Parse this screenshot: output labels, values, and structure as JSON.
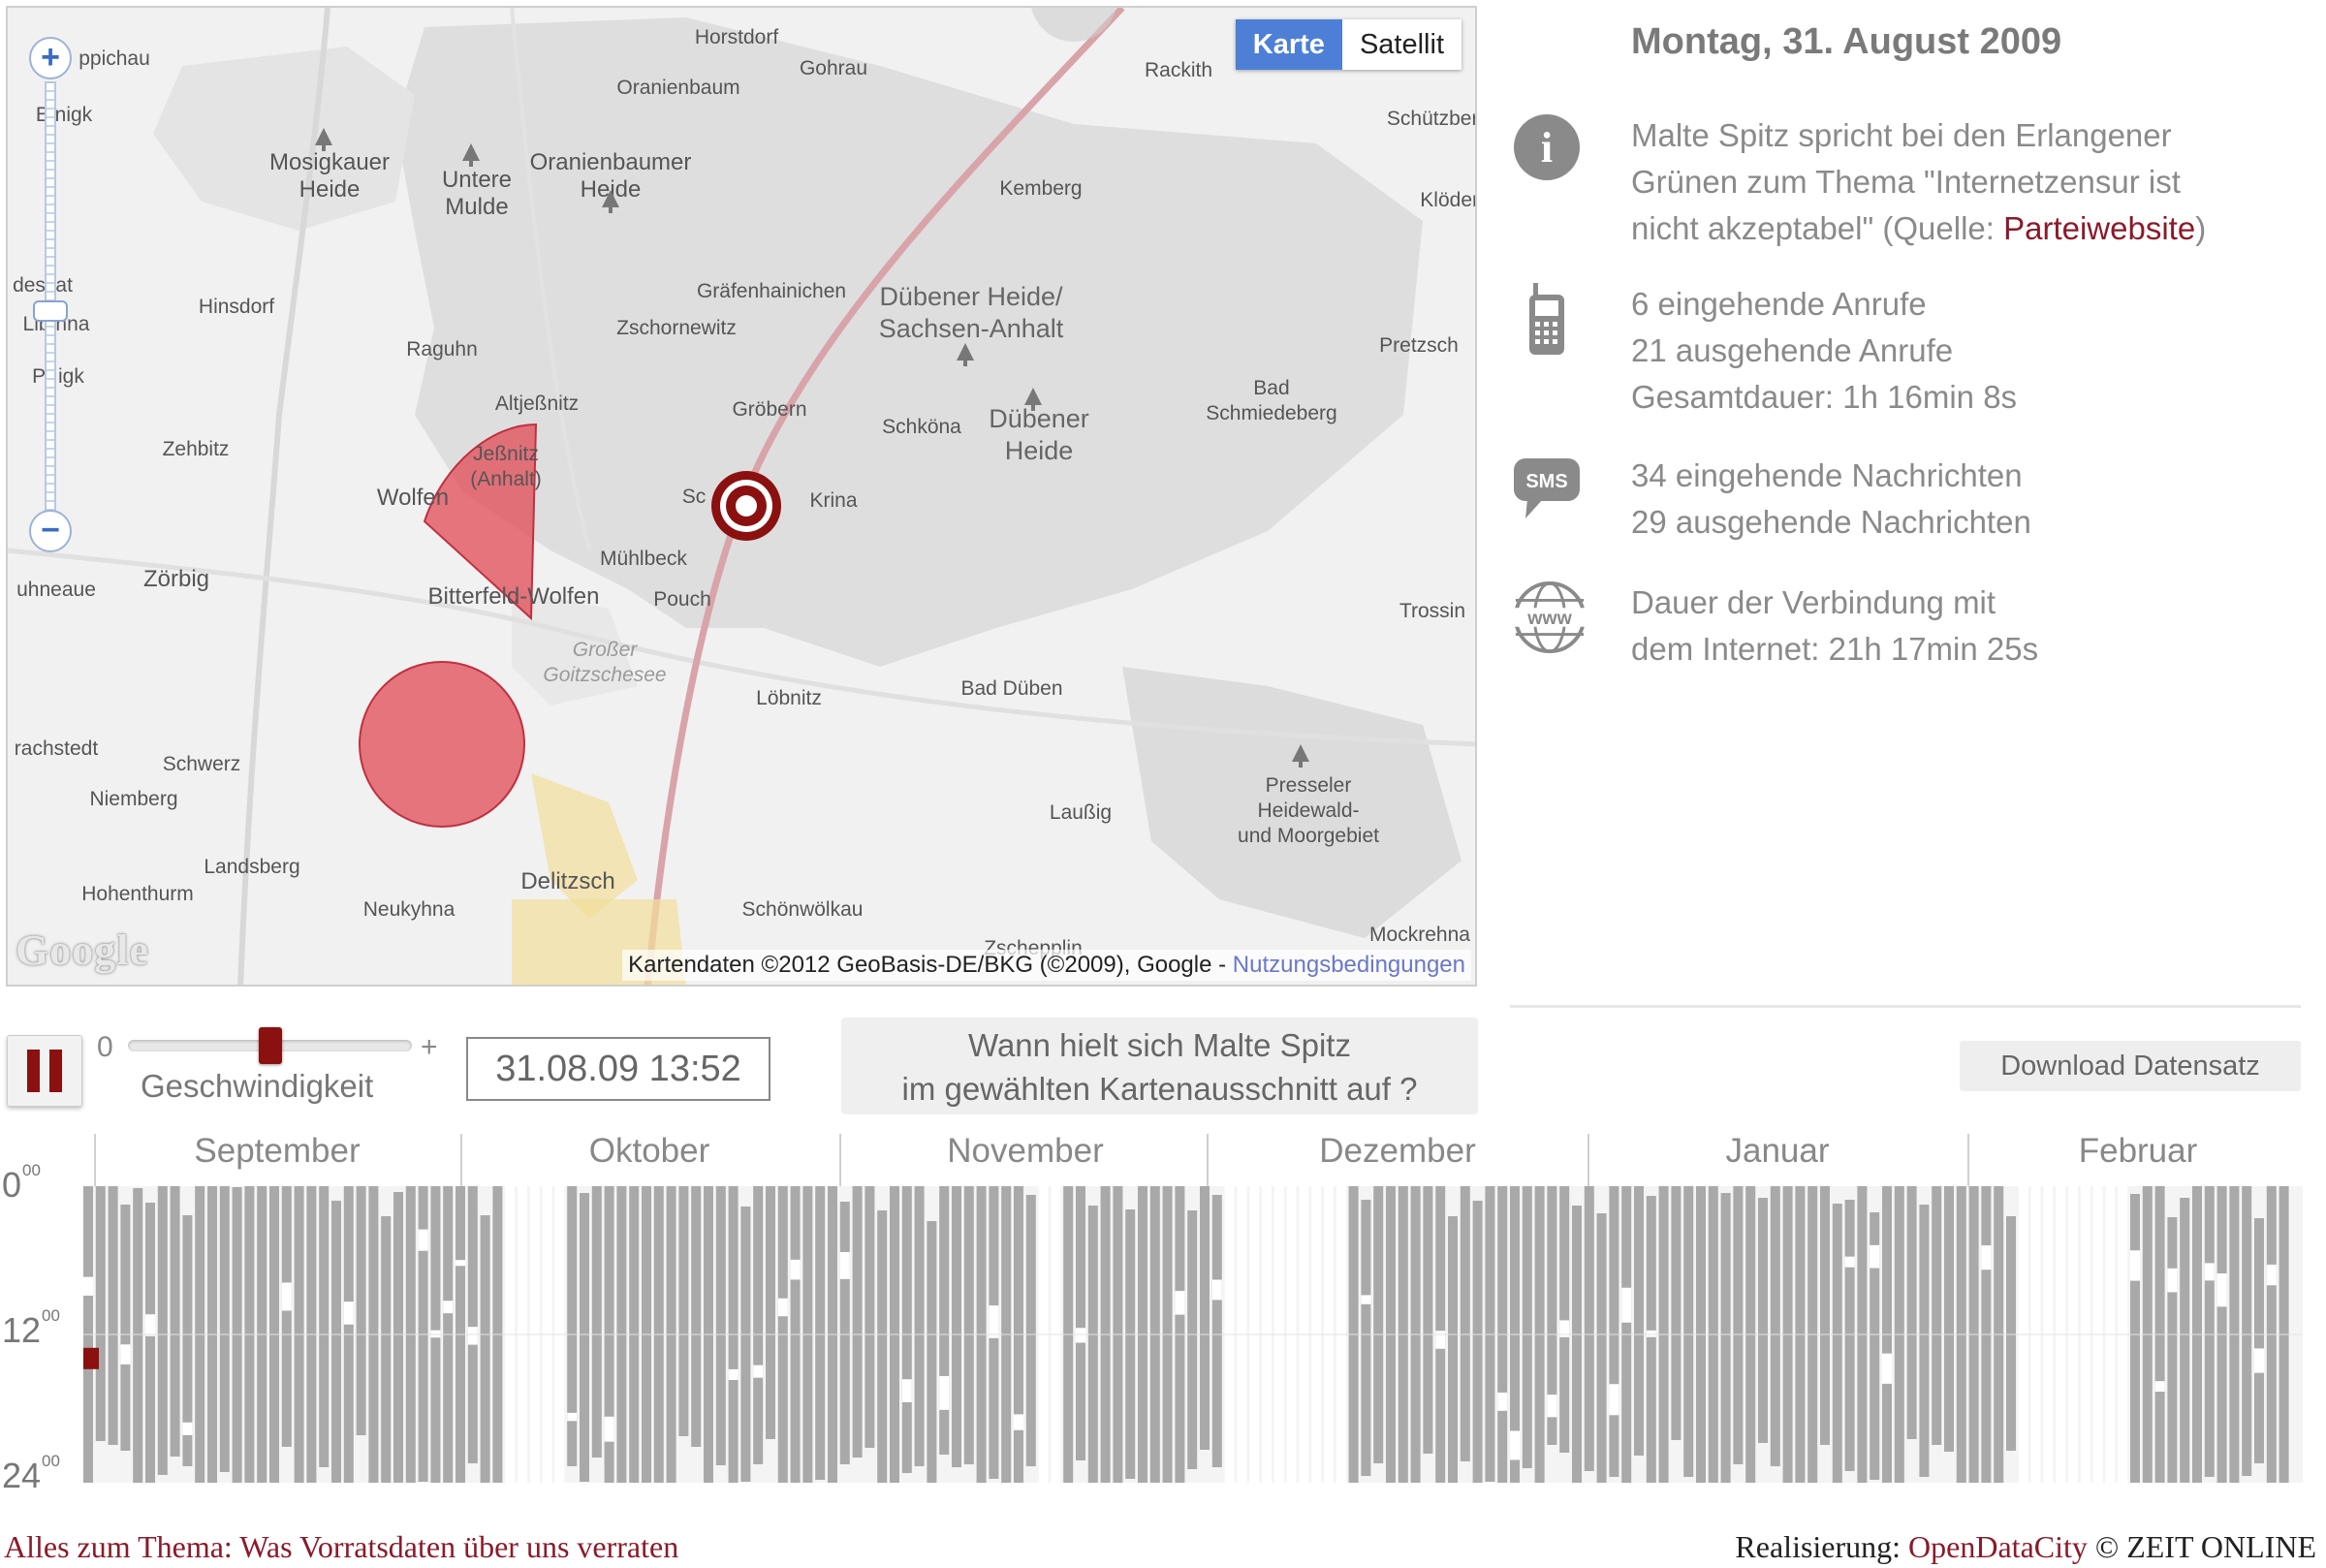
{
  "map": {
    "places": [
      {
        "name": "Horstdorf"
      },
      {
        "name": "Gohrau"
      },
      {
        "name": "Rackith"
      },
      {
        "name": "Oranienbaum"
      },
      {
        "name": "Mosigkauer\nHeide"
      },
      {
        "name": "Untere\nMulde"
      },
      {
        "name": "Oranienbaumer\nHeide"
      },
      {
        "name": "Kemberg"
      },
      {
        "name": "Schützberg"
      },
      {
        "name": "Klöden"
      },
      {
        "name": "Hinsdorf"
      },
      {
        "name": "Gräfenhainichen"
      },
      {
        "name": "Dübener Heide/\nSachsen-Anhalt"
      },
      {
        "name": "Zschornewitz"
      },
      {
        "name": "Raguhn"
      },
      {
        "name": "Pretzsch"
      },
      {
        "name": "Altjeßnitz"
      },
      {
        "name": "Gröbern"
      },
      {
        "name": "Schköna"
      },
      {
        "name": "Dübener\nHeide"
      },
      {
        "name": "Bad\nSchmiedeberg"
      },
      {
        "name": "Zehbitz"
      },
      {
        "name": "Jeßnitz\n(Anhalt)"
      },
      {
        "name": "Wolfen"
      },
      {
        "name": "Krina"
      },
      {
        "name": "Mühlbeck"
      },
      {
        "name": "Zörbig"
      },
      {
        "name": "Bitterfeld-Wolfen"
      },
      {
        "name": "Pouch"
      },
      {
        "name": "Trossin"
      },
      {
        "name": "Großer\nGoitzschesee"
      },
      {
        "name": "Löbnitz"
      },
      {
        "name": "Bad Düben"
      },
      {
        "name": "Schwerz"
      },
      {
        "name": "Niemberg"
      },
      {
        "name": "Presseler\nHeidewald-\nund Moorgebiet"
      },
      {
        "name": "Laußig"
      },
      {
        "name": "Landsberg"
      },
      {
        "name": "Delitzsch"
      },
      {
        "name": "Hohenthurm"
      },
      {
        "name": "Neukyhna"
      },
      {
        "name": "Schönwölkau"
      },
      {
        "name": "Zschepplin"
      },
      {
        "name": "Mockrehna"
      },
      {
        "name": "ppichau"
      },
      {
        "name": "E  nigk"
      },
      {
        "name": "dessat"
      },
      {
        "name": "Lib  nna"
      },
      {
        "name": "Pr  igk"
      },
      {
        "name": "uhneaue"
      },
      {
        "name": "rachstedt"
      },
      {
        "name": "Sc"
      }
    ],
    "zoom_in": "+",
    "zoom_out": "−",
    "type_buttons": {
      "map": "Karte",
      "satellite": "Satellit"
    },
    "google_logo": "Google",
    "attribution": "Kartendaten ©2012 GeoBasis-DE/BKG (©2009), Google - ",
    "terms_link": "Nutzungsbedingungen"
  },
  "info": {
    "date_title": "Montag, 31. August 2009",
    "event_line1": "Malte Spitz spricht bei den Erlangener",
    "event_line2": "Grünen zum Thema \"Internetzensur ist",
    "event_line3_a": "nicht akzeptabel\" (Quelle: ",
    "event_link": "Parteiwebsite",
    "event_line3_b": ")",
    "calls_in": "6 eingehende Anrufe",
    "calls_out": "21 ausgehende Anrufe",
    "calls_total": "Gesamtdauer: 1h 16min 8s",
    "sms_in": "34 eingehende Nachrichten",
    "sms_out": "29 ausgehende Nachrichten",
    "internet_line1": "Dauer der Verbindung mit",
    "internet_line2": "dem Internet: 21h 17min 25s",
    "sms_icon_text": "SMS",
    "www_icon_text": "www",
    "info_icon_text": "i"
  },
  "controls": {
    "speed_min": "0",
    "speed_max": "+",
    "speed_label": "Geschwindigkeit",
    "speed_value": 0.5,
    "datetime": "31.08.09 13:52",
    "query_line1": "Wann hielt sich Malte Spitz",
    "query_line2": "im gewählten Kartenausschnitt auf ?",
    "download": "Download  Datensatz"
  },
  "timeline": {
    "months": [
      "September",
      "Oktober",
      "November",
      "Dezember",
      "Januar",
      "Februar"
    ],
    "time_labels": [
      {
        "h": "0",
        "m": "00"
      },
      {
        "h": "12",
        "m": "00"
      },
      {
        "h": "24",
        "m": "00"
      }
    ],
    "current_day_index": 0,
    "current_time": "13:52"
  },
  "footer": {
    "left": "Alles zum Thema: Was Vorratsdaten über uns verraten",
    "right_prefix": "Realisierung: ",
    "right_link": "OpenDataCity",
    "right_suffix": " © ZEIT ONLINE"
  },
  "colors": {
    "accent": "#8b1010",
    "link": "#8b1a2a",
    "map_button": "#4d7fd6",
    "data_bar": "#a9a9a9"
  }
}
